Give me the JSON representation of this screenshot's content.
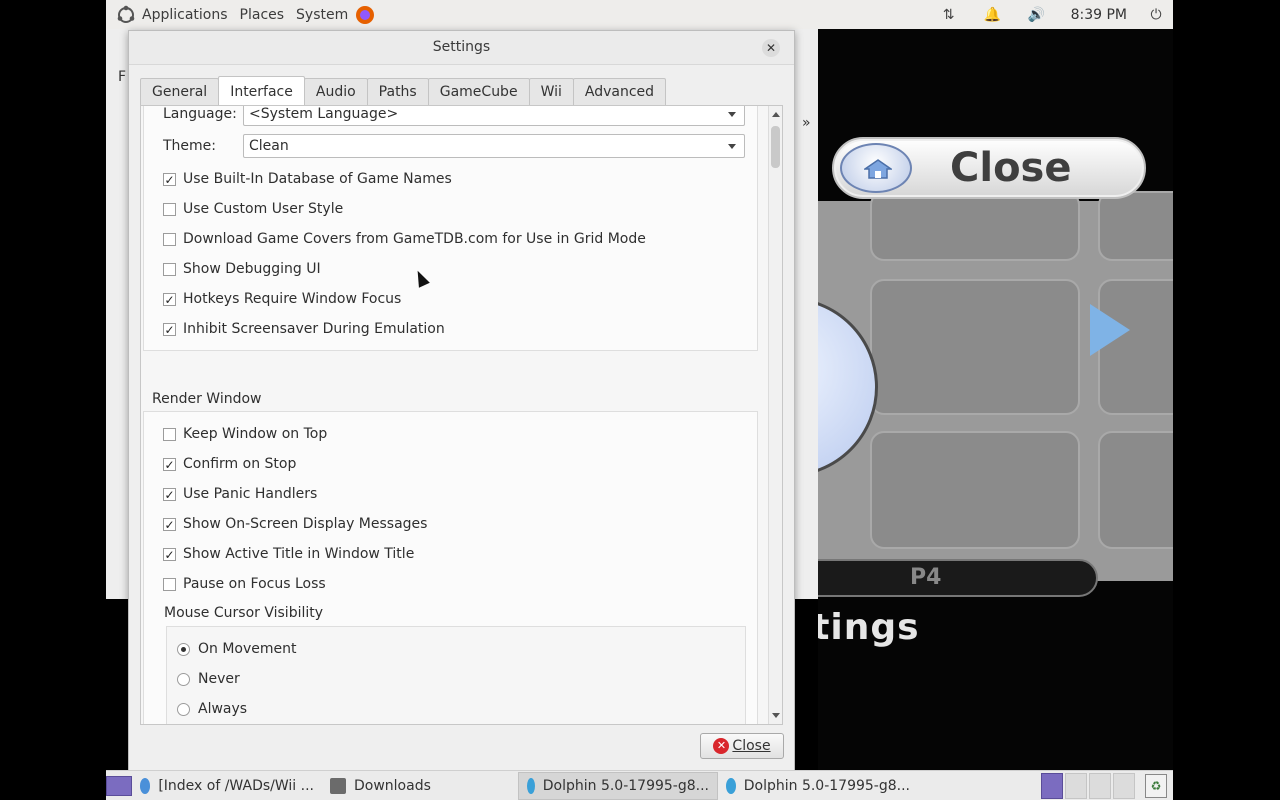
{
  "top_panel": {
    "menus": [
      "Applications",
      "Places",
      "System"
    ],
    "clock": "8:39 PM",
    "icons": [
      "ubuntu-logo-icon",
      "firefox-icon",
      "network-icon",
      "notification-icon",
      "volume-icon",
      "power-icon"
    ]
  },
  "background_app": {
    "menu_letter": "F",
    "chevron": "»",
    "close_label": "Close",
    "player_label": "P4",
    "settings_text": "ttings"
  },
  "dialog": {
    "title": "Settings",
    "tabs": [
      "General",
      "Interface",
      "Audio",
      "Paths",
      "GameCube",
      "Wii",
      "Advanced"
    ],
    "active_tab": "Interface",
    "language_label": "Language:",
    "language_value": "<System Language>",
    "theme_label": "Theme:",
    "theme_value": "Clean",
    "ui_checks": [
      {
        "label": "Use Built-In Database of Game Names",
        "checked": true
      },
      {
        "label": "Use Custom User Style",
        "checked": false
      },
      {
        "label": "Download Game Covers from GameTDB.com for Use in Grid Mode",
        "checked": false
      },
      {
        "label": "Show Debugging UI",
        "checked": false
      },
      {
        "label": "Hotkeys Require Window Focus",
        "checked": true
      },
      {
        "label": "Inhibit Screensaver During Emulation",
        "checked": true
      }
    ],
    "render_window_title": "Render Window",
    "render_checks": [
      {
        "label": "Keep Window on Top",
        "checked": false
      },
      {
        "label": "Confirm on Stop",
        "checked": true
      },
      {
        "label": "Use Panic Handlers",
        "checked": true
      },
      {
        "label": "Show On-Screen Display Messages",
        "checked": true
      },
      {
        "label": "Show Active Title in Window Title",
        "checked": true
      },
      {
        "label": "Pause on Focus Loss",
        "checked": false
      }
    ],
    "mouse_cursor_title": "Mouse Cursor Visibility",
    "mouse_options": [
      {
        "label": "On Movement",
        "selected": true
      },
      {
        "label": "Never",
        "selected": false
      },
      {
        "label": "Always",
        "selected": false
      }
    ],
    "close_button": "Close"
  },
  "taskbar": {
    "tasks": [
      {
        "label": "[Index of /WADs/Wii ...",
        "icon": "chrome-icon",
        "active": false
      },
      {
        "label": "Downloads",
        "icon": "folder-icon",
        "active": false
      },
      {
        "label": "Dolphin 5.0-17995-g8...",
        "icon": "dolphin-icon",
        "active": true
      },
      {
        "label": "Dolphin 5.0-17995-g8...",
        "icon": "dolphin-icon",
        "active": false
      }
    ]
  }
}
